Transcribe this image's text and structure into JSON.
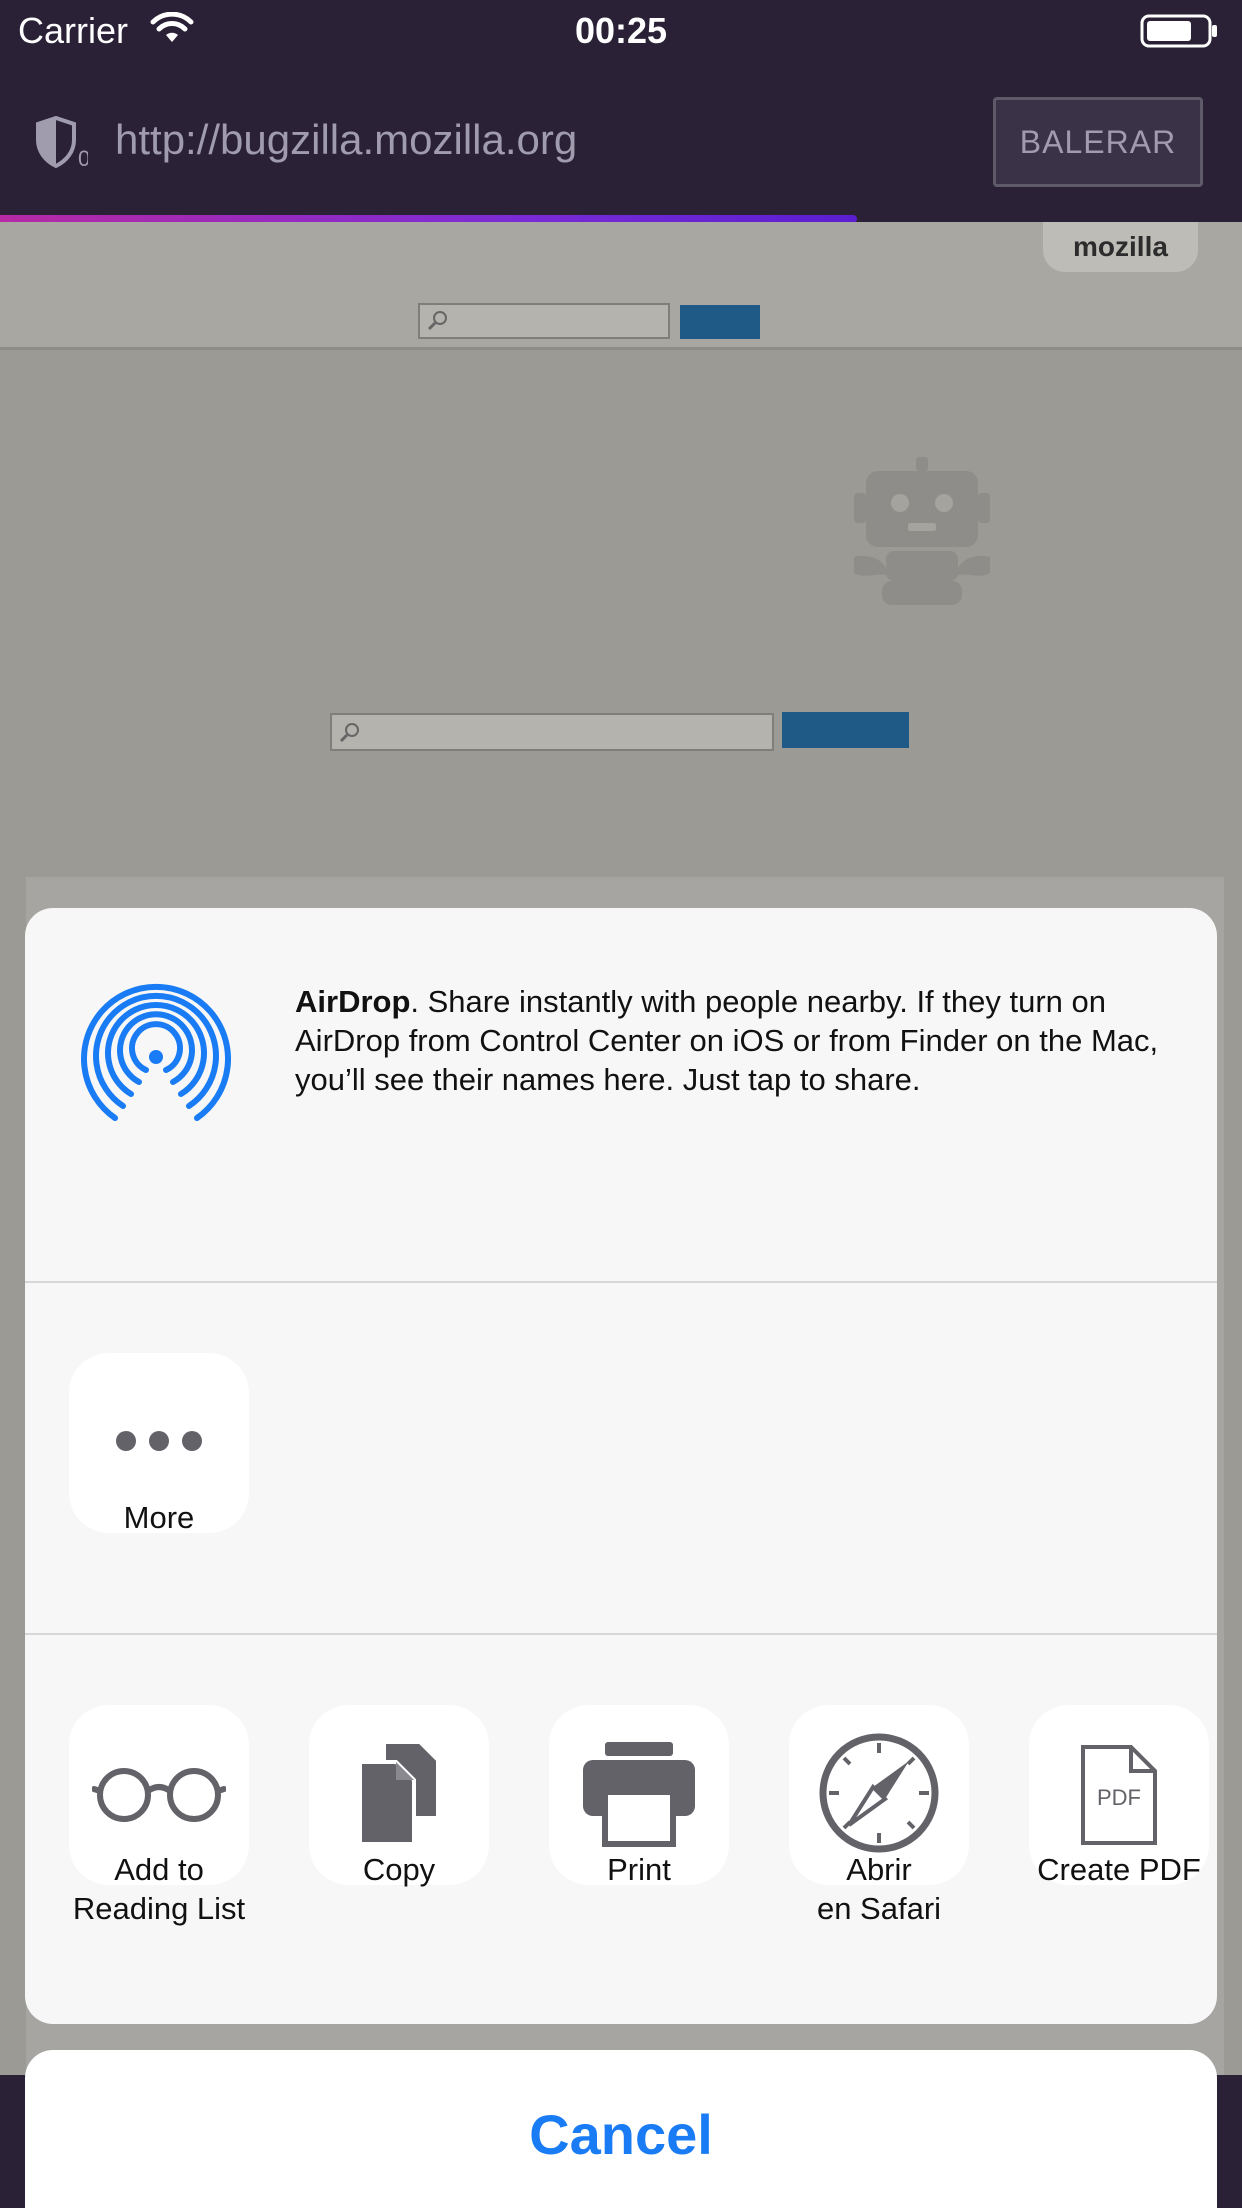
{
  "status_bar": {
    "carrier": "Carrier",
    "time": "00:25"
  },
  "url_bar": {
    "url": "http://bugzilla.mozilla.org",
    "tracker_count": "0",
    "cancel_button": "BALERAR",
    "load_progress": 0.69
  },
  "page": {
    "site_tab": "mozilla"
  },
  "share_sheet": {
    "airdrop": {
      "title": "AirDrop",
      "description": ". Share instantly with people nearby. If they turn on AirDrop from Control Center on iOS or from Finder on the Mac, you’ll see their names here. Just tap to share."
    },
    "more": {
      "label": "More"
    },
    "actions": [
      {
        "icon": "glasses-icon",
        "label_line1": "Add to",
        "label_line2": "Reading List"
      },
      {
        "icon": "copy-icon",
        "label_line1": "Copy",
        "label_line2": ""
      },
      {
        "icon": "printer-icon",
        "label_line1": "Print",
        "label_line2": ""
      },
      {
        "icon": "compass-icon",
        "label_line1": "Abrir",
        "label_line2": "en Safari"
      },
      {
        "icon": "pdf-icon",
        "label_line1": "Create PDF",
        "label_line2": "",
        "badge": "PDF"
      }
    ],
    "cancel": "Cancel"
  },
  "colors": {
    "chrome_bg": "#2a2136",
    "accent_blue": "#1a7cf4",
    "airdrop_blue": "#1a7cf4",
    "icon_gray": "#636268"
  }
}
